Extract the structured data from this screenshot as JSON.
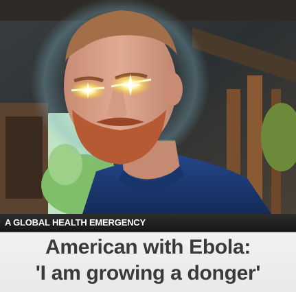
{
  "image": {
    "subject": "man-with-glowing-eyes",
    "colors": {
      "background_dark": "#2a2f33",
      "shirt": "#1d3b73",
      "skin": "#d9a089",
      "beard": "#b55a32",
      "glow": "#ffe36a",
      "window": "#bfe3c4",
      "wood": "#8a5a34"
    }
  },
  "banner": {
    "kicker": "A GLOBAL HEALTH EMERGENCY",
    "headline_line1": "American with Ebola:",
    "headline_line2": "'I am growing a donger'"
  }
}
